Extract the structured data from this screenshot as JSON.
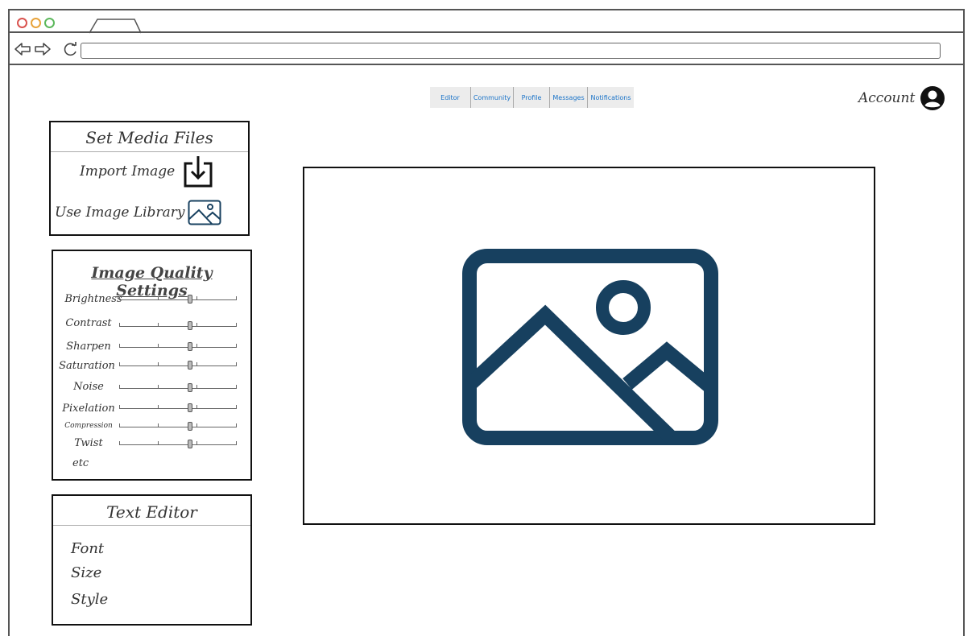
{
  "browser": {
    "url": ""
  },
  "top_menu": {
    "items": [
      {
        "label": "Editor"
      },
      {
        "label": "Community"
      },
      {
        "label": "Profile"
      },
      {
        "label": "Messages"
      },
      {
        "label": "Notifications"
      }
    ]
  },
  "account": {
    "label": "Account",
    "icon": "user-circle-icon"
  },
  "media_panel": {
    "title": "Set Media Files",
    "import_label": "Import Image",
    "import_icon": "download-icon",
    "library_label": "Use Image Library",
    "library_icon": "image-icon"
  },
  "quality_panel": {
    "title": "Image Quality Settings",
    "sliders": [
      {
        "label": "Brightness",
        "value": 0.6
      },
      {
        "label": "Contrast",
        "value": 0.6
      },
      {
        "label": "Sharpen",
        "value": 0.6
      },
      {
        "label": "Saturation",
        "value": 0.6
      },
      {
        "label": "Noise",
        "value": 0.6
      },
      {
        "label": "Pixelation",
        "value": 0.6
      },
      {
        "label": "Compression",
        "value": 0.6
      },
      {
        "label": "Twist",
        "value": 0.6
      }
    ],
    "etc_label": "etc"
  },
  "text_editor": {
    "title": "Text Editor",
    "options": [
      "Font",
      "Size",
      "Style"
    ]
  },
  "canvas": {
    "icon": "image-placeholder-icon",
    "icon_color": "#17405f"
  }
}
